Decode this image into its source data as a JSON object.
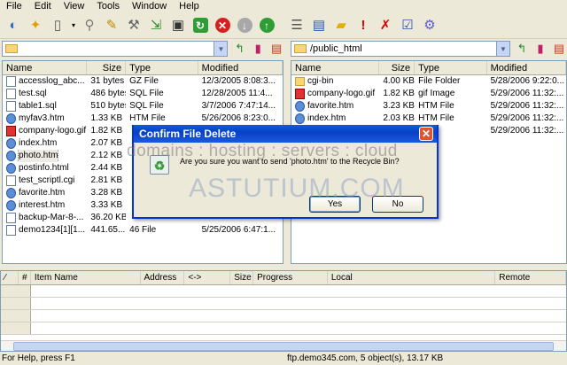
{
  "menu": [
    "File",
    "Edit",
    "View",
    "Tools",
    "Window",
    "Help"
  ],
  "toolbar_icons": [
    "connect-icon",
    "wizard-icon",
    "new-icon",
    "dropdown-icon",
    "plug-icon",
    "pen-icon",
    "wrench-icon",
    "download-icon",
    "floppy-icon",
    "refresh-icon",
    "stop-icon",
    "down-arrow-icon",
    "up-arrow-icon",
    "edit-icon",
    "view-icon",
    "folder-new-icon",
    "exclamation-icon",
    "delete-icon",
    "check-icon",
    "gear-icon"
  ],
  "left": {
    "path": "",
    "columns": [
      "Name",
      "Size",
      "Type",
      "Modified"
    ],
    "files": [
      {
        "name": "accesslog_abc...",
        "size": "31 bytes",
        "type": "GZ File",
        "modified": "12/3/2005 8:08:3...",
        "icon": "doc"
      },
      {
        "name": "test.sql",
        "size": "486 bytes",
        "type": "SQL File",
        "modified": "12/28/2005 11:4...",
        "icon": "doc"
      },
      {
        "name": "table1.sql",
        "size": "510 bytes",
        "type": "SQL File",
        "modified": "3/7/2006 7:47:14...",
        "icon": "doc"
      },
      {
        "name": "myfav3.htm",
        "size": "1.33 KB",
        "type": "HTM File",
        "modified": "5/26/2006 8:23:0...",
        "icon": "globe"
      },
      {
        "name": "company-logo.gif",
        "size": "1.82 KB",
        "type": "",
        "modified": "",
        "icon": "red"
      },
      {
        "name": "index.htm",
        "size": "2.07 KB",
        "type": "",
        "modified": "",
        "icon": "globe"
      },
      {
        "name": "photo.htm",
        "size": "2.12 KB",
        "type": "",
        "modified": "",
        "icon": "globe",
        "selected": true
      },
      {
        "name": "postinfo.html",
        "size": "2.44 KB",
        "type": "",
        "modified": "",
        "icon": "globe"
      },
      {
        "name": "test_scriptl.cgi",
        "size": "2.81 KB",
        "type": "",
        "modified": "",
        "icon": "doc"
      },
      {
        "name": "favorite.htm",
        "size": "3.28 KB",
        "type": "",
        "modified": "",
        "icon": "globe"
      },
      {
        "name": "interest.htm",
        "size": "3.33 KB",
        "type": "",
        "modified": "",
        "icon": "globe"
      },
      {
        "name": "backup-Mar-8-...",
        "size": "36.20 KB",
        "type": "",
        "modified": "",
        "icon": "doc"
      },
      {
        "name": "demo1234[1][1...",
        "size": "441.65...",
        "type": "46 File",
        "modified": "5/25/2006 6:47:1...",
        "icon": "doc"
      }
    ]
  },
  "right": {
    "path": "/public_html",
    "columns": [
      "Name",
      "Size",
      "Type",
      "Modified"
    ],
    "files": [
      {
        "name": "cgi-bin",
        "size": "4.00 KB",
        "type": "File Folder",
        "modified": "5/28/2006 9:22:0...",
        "icon": "folder"
      },
      {
        "name": "company-logo.gif",
        "size": "1.82 KB",
        "type": "gif Image",
        "modified": "5/29/2006 11:32:...",
        "icon": "red"
      },
      {
        "name": "favorite.htm",
        "size": "3.23 KB",
        "type": "HTM File",
        "modified": "5/29/2006 11:32:...",
        "icon": "globe"
      },
      {
        "name": "index.htm",
        "size": "2.03 KB",
        "type": "HTM File",
        "modified": "5/29/2006 11:32:...",
        "icon": "globe"
      },
      {
        "name": "",
        "size": "",
        "type": "File",
        "modified": "5/29/2006 11:32:...",
        "icon": "none"
      }
    ]
  },
  "queue": {
    "columns": [
      "#",
      "Item Name",
      "Address",
      "<->",
      "Size",
      "Progress",
      "Local",
      "Remote"
    ]
  },
  "status": {
    "left": "For Help, press F1",
    "right": "ftp.demo345.com, 5 object(s), 13.17 KB"
  },
  "dialog": {
    "title": "Confirm File Delete",
    "message": "Are you sure you want to send 'photo.htm' to the Recycle Bin?",
    "yes": "Yes",
    "no": "No"
  },
  "watermark": {
    "line1": "domains : hosting : servers : cloud",
    "line2": "ASTUTIUM.COM"
  }
}
